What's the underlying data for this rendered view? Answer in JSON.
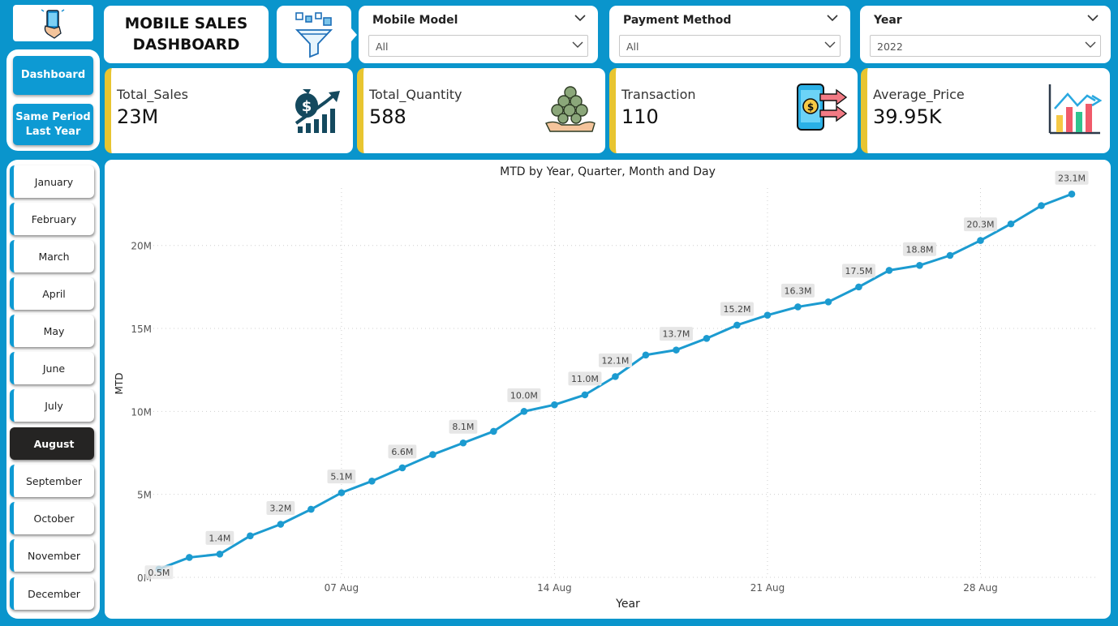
{
  "colors": {
    "accent": "#0d9ad3",
    "line": "#1c9bd0",
    "kpi_bar": "#e8c530",
    "active_month": "#252423"
  },
  "logo": {
    "icon": "phone-hand-icon"
  },
  "nav": {
    "dashboard": "Dashboard",
    "same_period": "Same Period\nLast Year"
  },
  "months": [
    "January",
    "February",
    "March",
    "April",
    "May",
    "June",
    "July",
    "August",
    "September",
    "October",
    "November",
    "December"
  ],
  "active_month": "August",
  "title": "MOBILE SALES\nDASHBOARD",
  "filter_icon": "funnel-icon",
  "slicers": {
    "model": {
      "label": "Mobile Model",
      "value": "All"
    },
    "payment": {
      "label": "Payment Method",
      "value": "All"
    },
    "year": {
      "label": "Year",
      "value": "2022"
    }
  },
  "kpis": {
    "sales": {
      "label": "Total_Sales",
      "value": "23M",
      "icon": "money-bag-growth-icon"
    },
    "qty": {
      "label": "Total_Quantity",
      "value": "588",
      "icon": "coins-hand-icon"
    },
    "trans": {
      "label": "Transaction",
      "value": "110",
      "icon": "phone-transfer-icon"
    },
    "avg": {
      "label": "Average_Price",
      "value": "39.95K",
      "icon": "bar-chart-trend-icon"
    }
  },
  "chart_data": {
    "type": "line",
    "title": "MTD by Year, Quarter, Month and Day",
    "xlabel": "Year",
    "ylabel": "MTD",
    "x": [
      1,
      2,
      3,
      4,
      5,
      6,
      7,
      8,
      9,
      10,
      11,
      12,
      13,
      14,
      15,
      16,
      17,
      18,
      19,
      20,
      21,
      22,
      23,
      24,
      25,
      26,
      27,
      28,
      29,
      30,
      31
    ],
    "x_ticks": [
      {
        "day": 7,
        "label": "07 Aug"
      },
      {
        "day": 14,
        "label": "14 Aug"
      },
      {
        "day": 21,
        "label": "21 Aug"
      },
      {
        "day": 28,
        "label": "28 Aug"
      }
    ],
    "y_ticks": [
      {
        "value": 0,
        "label": "0M"
      },
      {
        "value": 5,
        "label": "5M"
      },
      {
        "value": 10,
        "label": "10M"
      },
      {
        "value": 15,
        "label": "15M"
      },
      {
        "value": 20,
        "label": "20M"
      }
    ],
    "ylim": [
      0,
      23.7
    ],
    "xlim": [
      0.55,
      31.8
    ],
    "values": [
      0.5,
      1.2,
      1.4,
      2.5,
      3.2,
      4.1,
      5.1,
      5.8,
      6.6,
      7.4,
      8.1,
      8.8,
      10.0,
      10.4,
      11.0,
      12.1,
      13.4,
      13.7,
      14.4,
      15.2,
      15.8,
      16.3,
      16.6,
      17.5,
      18.5,
      18.8,
      19.4,
      20.3,
      21.3,
      22.4,
      23.1
    ],
    "data_labels": [
      {
        "day": 1,
        "label": "0.5M"
      },
      {
        "day": 3,
        "label": "1.4M"
      },
      {
        "day": 5,
        "label": "3.2M"
      },
      {
        "day": 7,
        "label": "5.1M"
      },
      {
        "day": 9,
        "label": "6.6M"
      },
      {
        "day": 11,
        "label": "8.1M"
      },
      {
        "day": 13,
        "label": "10.0M"
      },
      {
        "day": 15,
        "label": "11.0M"
      },
      {
        "day": 16,
        "label": "12.1M"
      },
      {
        "day": 18,
        "label": "13.7M"
      },
      {
        "day": 20,
        "label": "15.2M"
      },
      {
        "day": 22,
        "label": "16.3M"
      },
      {
        "day": 24,
        "label": "17.5M"
      },
      {
        "day": 26,
        "label": "18.8M"
      },
      {
        "day": 28,
        "label": "20.3M"
      },
      {
        "day": 31,
        "label": "23.1M"
      }
    ],
    "grid": true
  }
}
